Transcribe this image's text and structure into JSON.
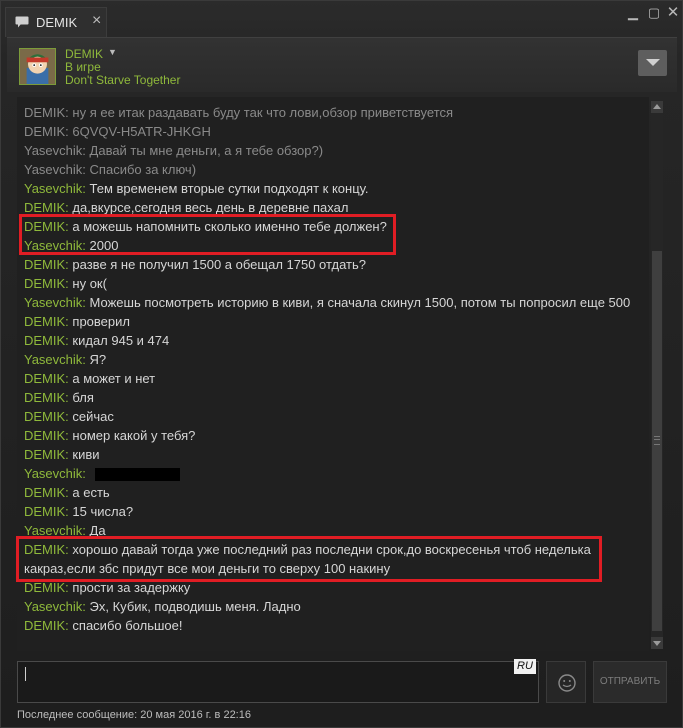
{
  "tab": {
    "title": "DEMIK",
    "close": "×"
  },
  "window_controls": {
    "minimize": "▁",
    "maximize": "▢",
    "close": "✕"
  },
  "header": {
    "name": "DEMIK",
    "status": "В игре",
    "game": "Don't Starve Together"
  },
  "messages": [
    {
      "sender": "DEMIK",
      "text": "ну я ее итак раздавать буду так что лови,обзор приветствуется",
      "old": true
    },
    {
      "sender": "DEMIK",
      "text": "6QVQV-H5ATR-JHKGH",
      "old": true
    },
    {
      "sender": "Yasevchik",
      "text": "Давай ты мне деньги, а я тебе обзор?)",
      "old": true
    },
    {
      "sender": "Yasevchik",
      "text": "Спасибо за ключ)",
      "old": true
    },
    {
      "sender": "Yasevchik",
      "text": "Тем временем вторые сутки подходят к концу."
    },
    {
      "sender": "DEMIK",
      "text": "да,вкурсе,сегодня весь день в деревне пахал"
    },
    {
      "sender": "DEMIK",
      "text": "а можешь напомнить сколько именно тебе должен?"
    },
    {
      "sender": "Yasevchik",
      "text": "2000"
    },
    {
      "sender": "DEMIK",
      "text": "разве я не получил 1500 а обещал 1750 отдать?"
    },
    {
      "sender": "DEMIK",
      "text": "ну  ок("
    },
    {
      "sender": "Yasevchik",
      "text": "Можешь посмотреть историю в киви, я сначала скинул 1500, потом ты попросил еще 500"
    },
    {
      "sender": "DEMIK",
      "text": "проверил"
    },
    {
      "sender": "DEMIK",
      "text": "кидал 945 и 474"
    },
    {
      "sender": "Yasevchik",
      "text": "Я?"
    },
    {
      "sender": "DEMIK",
      "text": "а может и нет"
    },
    {
      "sender": "DEMIK",
      "text": "бля"
    },
    {
      "sender": "DEMIK",
      "text": "сейчас"
    },
    {
      "sender": "DEMIK",
      "text": "номер какой у тебя?"
    },
    {
      "sender": "DEMIK",
      "text": "киви"
    },
    {
      "sender": "Yasevchik",
      "text": ""
    },
    {
      "sender": "DEMIK",
      "text": "а есть"
    },
    {
      "sender": "DEMIK",
      "text": "15 числа?"
    },
    {
      "sender": "Yasevchik",
      "text": "Да"
    },
    {
      "sender": "DEMIK",
      "text": "хорошо давай тогда уже последний раз последни срок,до воскресенья чтоб неделька какраз,если збс придут все мои деньги то сверху 100 накину"
    },
    {
      "sender": "DEMIK",
      "text": "прости за задержку"
    },
    {
      "sender": "Yasevchik",
      "text": "Эх, Кубик, подводишь меня. Ладно"
    },
    {
      "sender": "DEMIK",
      "text": "спасибо большое!"
    }
  ],
  "input": {
    "lang": "RU",
    "value": ""
  },
  "send_label": "ОТПРАВИТЬ",
  "footer": {
    "last_message": "Последнее сообщение: 20 мая 2016 г. в 22:16"
  },
  "colors": {
    "name_green": "#8fb93b",
    "highlight_red": "#e01d24"
  }
}
